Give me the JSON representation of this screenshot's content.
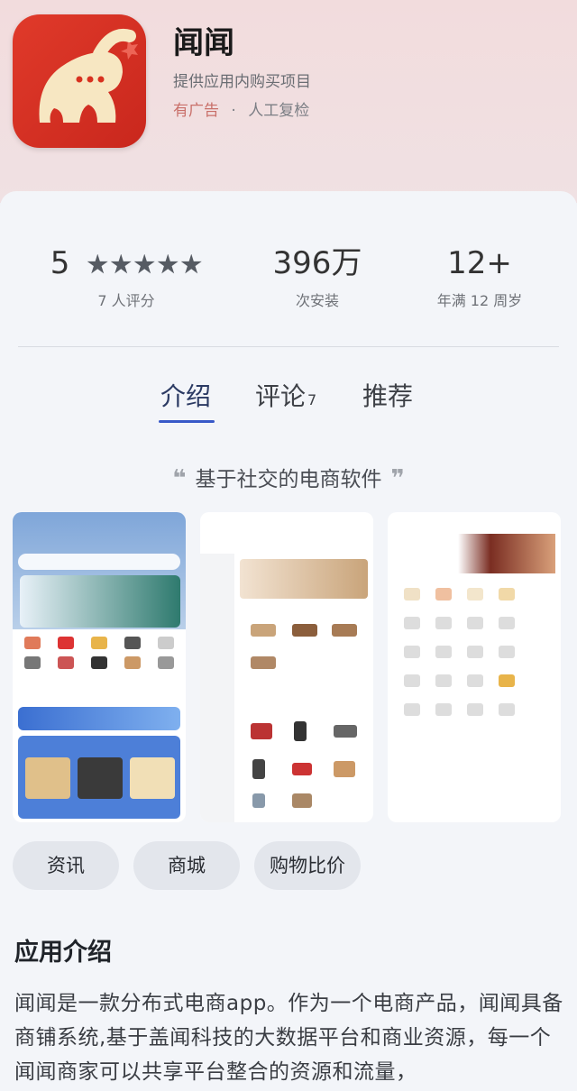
{
  "app": {
    "name": "闻闻",
    "subtitle": "提供应用内购买项目",
    "ad_label": "有广告",
    "dot": "·",
    "review_label": "人工复检"
  },
  "stats": {
    "rating": {
      "value": "5",
      "stars": 5,
      "caption": "7 人评分"
    },
    "installs": {
      "value": "396万",
      "caption": "次安装"
    },
    "age": {
      "value": "12+",
      "caption": "年满 12 周岁"
    }
  },
  "tabs": [
    {
      "label": "介绍",
      "active": true
    },
    {
      "label": "评论",
      "count": "7"
    },
    {
      "label": "推荐"
    }
  ],
  "tagline": "基于社交的电商软件",
  "tags": [
    "资讯",
    "商城",
    "购物比价"
  ],
  "intro": {
    "title": "应用介绍",
    "body": "闻闻是一款分布式电商app。作为一个电商产品，闻闻具备商铺系统,基于盖闻科技的大数据平台和商业资源，每一个闻闻商家可以共享平台整合的资源和流量，"
  },
  "colors": {
    "icon_red": "#d8311f",
    "accent_blue": "#3859c8",
    "header_bg": "#f2dcdd"
  }
}
